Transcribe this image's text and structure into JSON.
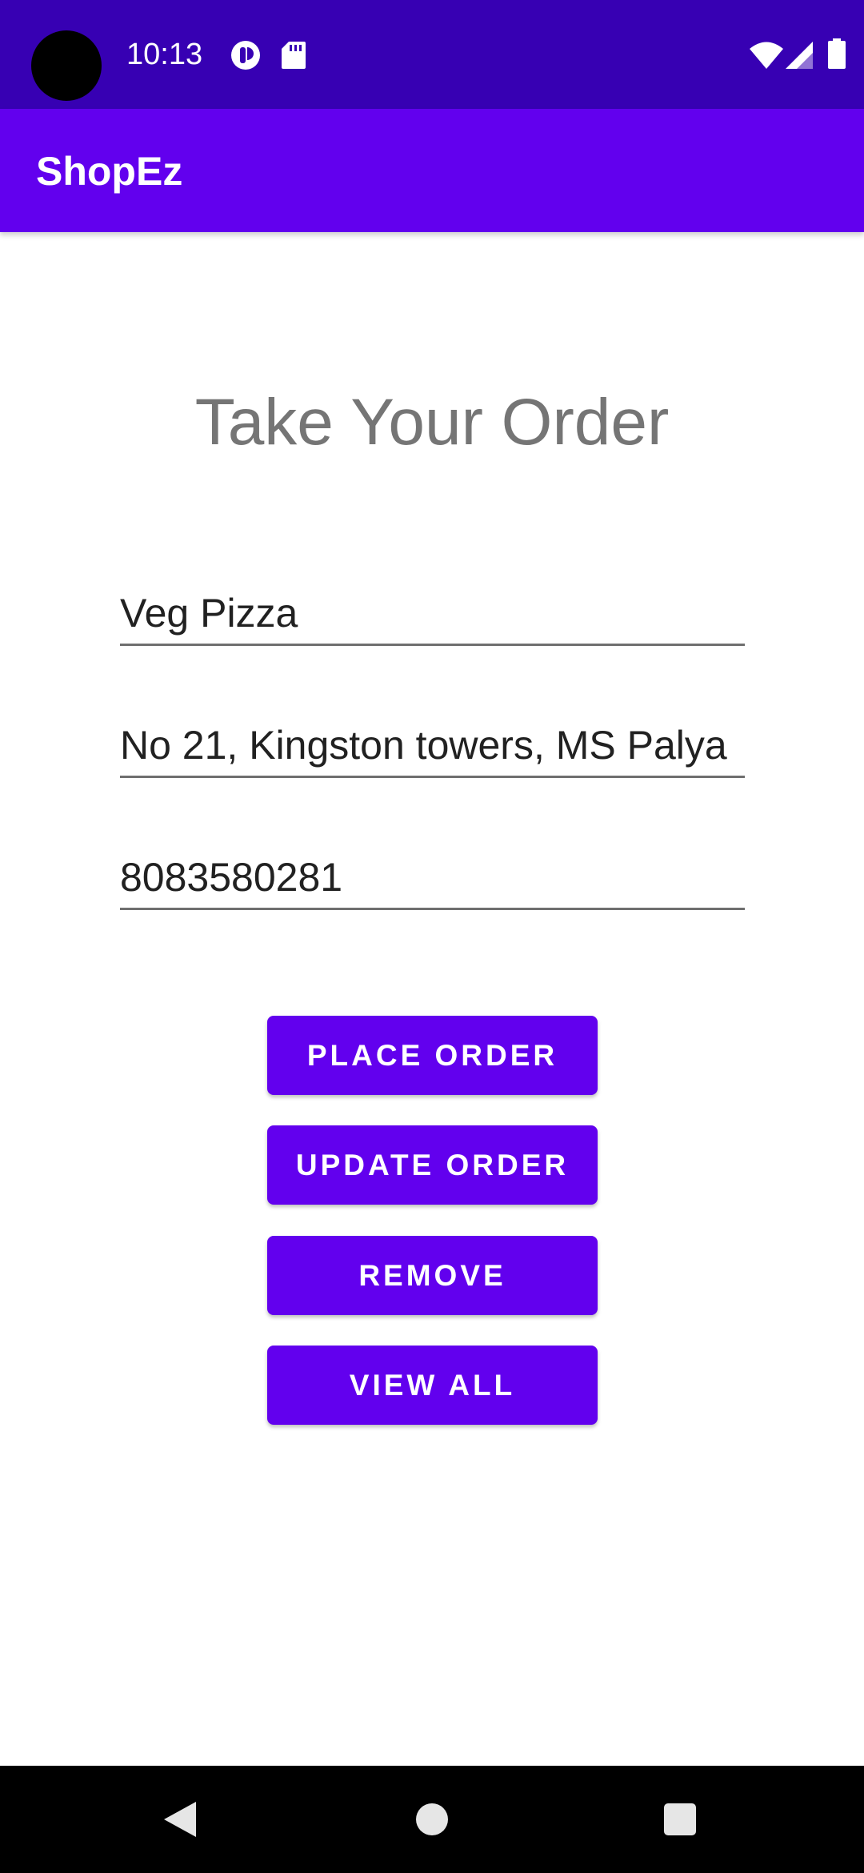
{
  "status_bar": {
    "time": "10:13",
    "icons": [
      "camera-hole",
      "data-saver-icon",
      "sd-card-icon",
      "wifi-icon",
      "signal-icon",
      "battery-icon"
    ],
    "background_color": "#3700B3"
  },
  "app_bar": {
    "title": "ShopEz",
    "background_color": "#6200EE"
  },
  "main": {
    "heading": "Take Your Order",
    "fields": {
      "item": {
        "value": "Veg Pizza"
      },
      "address": {
        "value": "No 21, Kingston towers, MS Palya"
      },
      "phone": {
        "value": "8083580281"
      }
    },
    "buttons": {
      "place_order": "PLACE ORDER",
      "update_order": "UPDATE ORDER",
      "remove": "REMOVE",
      "view_all": "VIEW ALL"
    },
    "accent_color": "#6200EE"
  },
  "nav_bar": {
    "icons": [
      "back-icon",
      "home-icon",
      "recents-icon"
    ]
  }
}
